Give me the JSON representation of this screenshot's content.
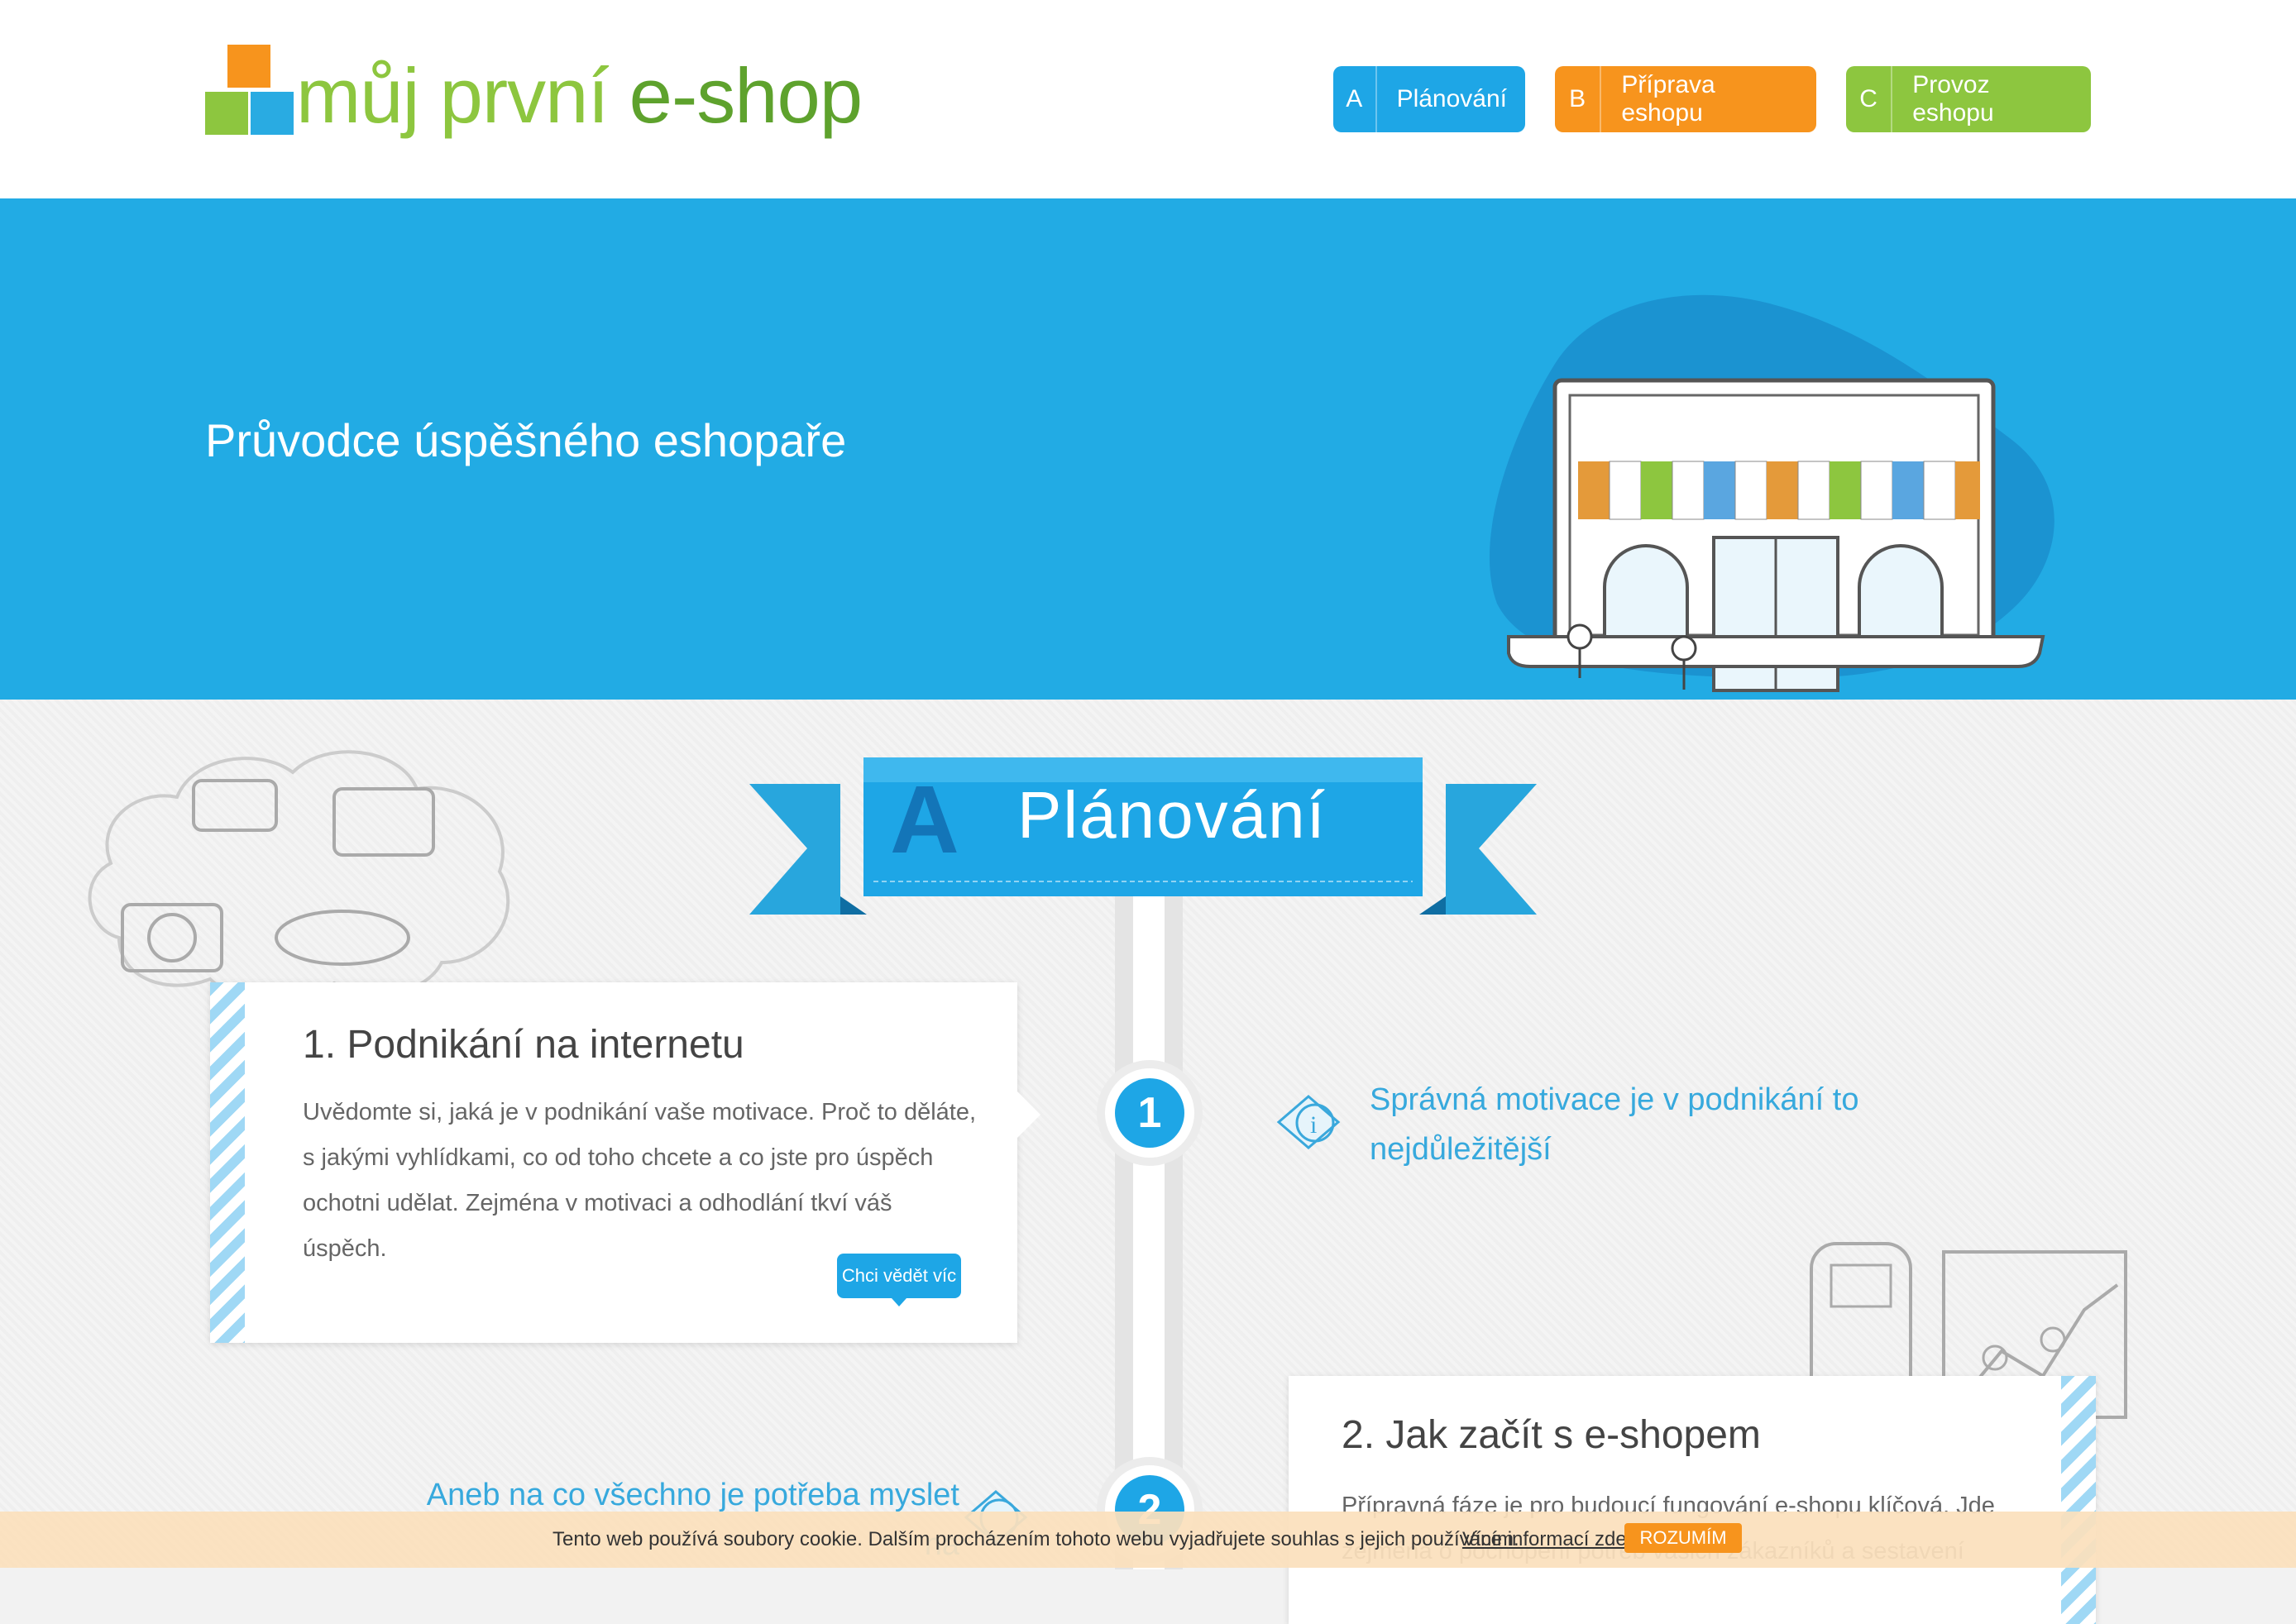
{
  "header": {
    "logo_part1": "můj první",
    "logo_part2": " e-shop",
    "nav": [
      {
        "letter": "A",
        "label": "Plánování",
        "color": "#1ea6e6"
      },
      {
        "letter": "B",
        "label": "Příprava eshopu",
        "color": "#f7941d"
      },
      {
        "letter": "C",
        "label": "Provoz eshopu",
        "color": "#8dc63f"
      }
    ]
  },
  "hero": {
    "title": "Průvodce úspěšného eshopaře",
    "background": "#22abe4"
  },
  "section": {
    "letter": "A",
    "title": "Plánování"
  },
  "steps": [
    {
      "number": "1",
      "title": "1. Podnikání na internetu",
      "text": "Uvědomte si, jaká je v podnikání vaše motivace. Proč to děláte, s jakými vyhlídkami, co od toho chcete a co jste pro úspěch ochotni udělat. Zejména v motivaci a odhodlání tkví váš úspěch.",
      "button": "Chci vědět víc",
      "tip": "Správná motivace je v podnikání to nejdůležitější"
    },
    {
      "number": "2",
      "title": "2. Jak začít s e-shopem",
      "text": "Přípravná fáze je pro budoucí fungování e-shopu klíčová. Jde zejména o pochopení potřeb vašich zákazníků a sestavení",
      "tip": "Aneb na co všechno je potřeba myslet na"
    }
  ],
  "cookie": {
    "text": "Tento web používá soubory cookie. Dalším procházením tohoto webu vyjadřujete souhlas s jejich používáním.",
    "link": "Více informací zde",
    "button": "ROZUMÍM"
  }
}
